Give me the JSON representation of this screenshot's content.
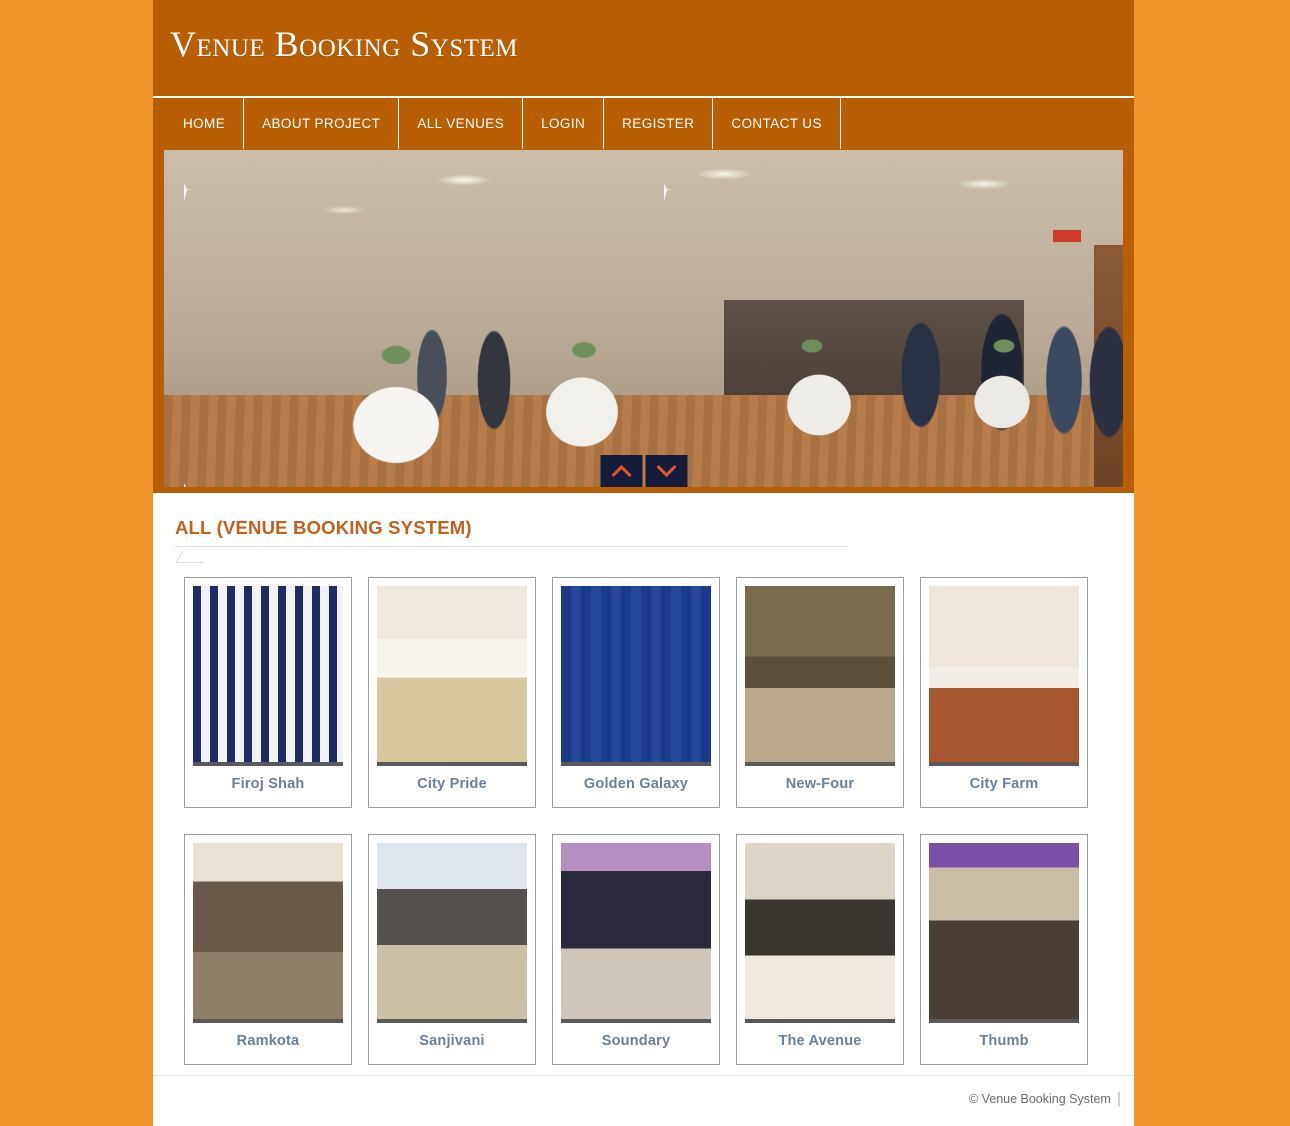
{
  "site": {
    "title": "Venue Booking System",
    "brand_brown": "#b85e04",
    "page_orange": "#f0962c",
    "accent_orange": "#c4601c"
  },
  "nav": {
    "items": [
      {
        "label": "HOME",
        "name": "nav-home"
      },
      {
        "label": "ABOUT PROJECT",
        "name": "nav-about-project"
      },
      {
        "label": "ALL VENUES",
        "name": "nav-all-venues"
      },
      {
        "label": "LOGIN",
        "name": "nav-login"
      },
      {
        "label": "REGISTER",
        "name": "nav-register"
      },
      {
        "label": "CONTACT US",
        "name": "nav-contact-us"
      }
    ]
  },
  "carousel": {
    "prev_icon": "chevron-up-icon",
    "next_icon": "chevron-down-icon",
    "slide_alt": "Conference hall with guests and cocktail tables"
  },
  "main": {
    "section_title": "ALL (VENUE BOOKING SYSTEM)",
    "venues": [
      {
        "name": "Firoj Shah",
        "thumb": "ph-firoj"
      },
      {
        "name": "City Pride",
        "thumb": "ph-citypride"
      },
      {
        "name": "Golden Galaxy",
        "thumb": "ph-golden"
      },
      {
        "name": "New-Four",
        "thumb": "ph-newfour"
      },
      {
        "name": "City Farm",
        "thumb": "ph-cityfarm"
      },
      {
        "name": "Ramkota",
        "thumb": "ph-ramkota"
      },
      {
        "name": "Sanjivani",
        "thumb": "ph-sanjivani"
      },
      {
        "name": "Soundary",
        "thumb": "ph-soundary"
      },
      {
        "name": "The Avenue",
        "thumb": "ph-avenue"
      },
      {
        "name": "Thumb",
        "thumb": "ph-thumb"
      }
    ]
  },
  "footer": {
    "copyright": "© Venue Booking System",
    "separator": "|"
  }
}
